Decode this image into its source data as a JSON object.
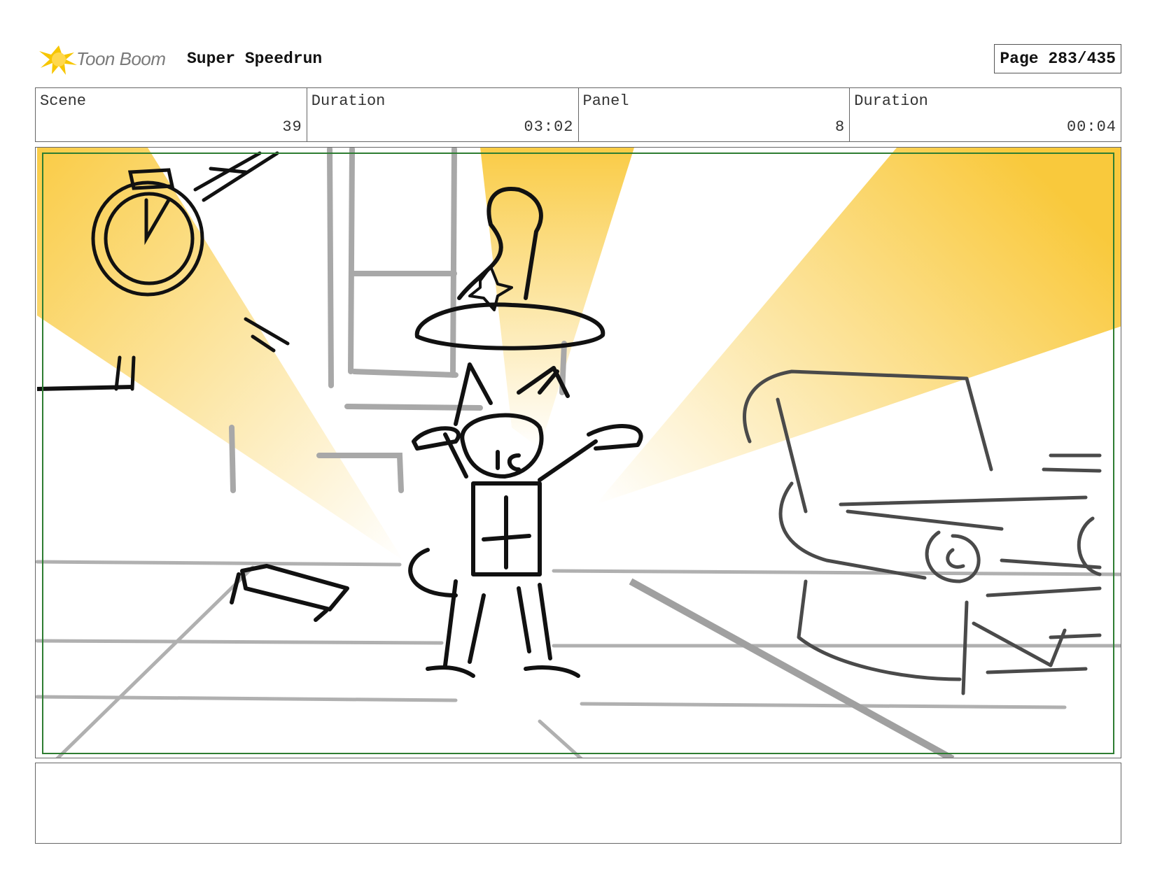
{
  "header": {
    "brand_name": "Toon Boom",
    "project_title": "Super Speedrun",
    "page_label": "Page 283/435"
  },
  "info_fields": [
    {
      "label": "Scene",
      "value": "39"
    },
    {
      "label": "Duration",
      "value": "03:02"
    },
    {
      "label": "Panel",
      "value": "8"
    },
    {
      "label": "Duration",
      "value": "00:04"
    }
  ],
  "panel": {
    "image_description": "",
    "safe_area_color": "#2e7d32",
    "spotlight_color": "#f9c93c"
  },
  "notes": {
    "text": ""
  },
  "colors": {
    "logo_yellow": "#f7c600",
    "brand_gray": "#7a7a7a",
    "frame_border": "#666666"
  }
}
